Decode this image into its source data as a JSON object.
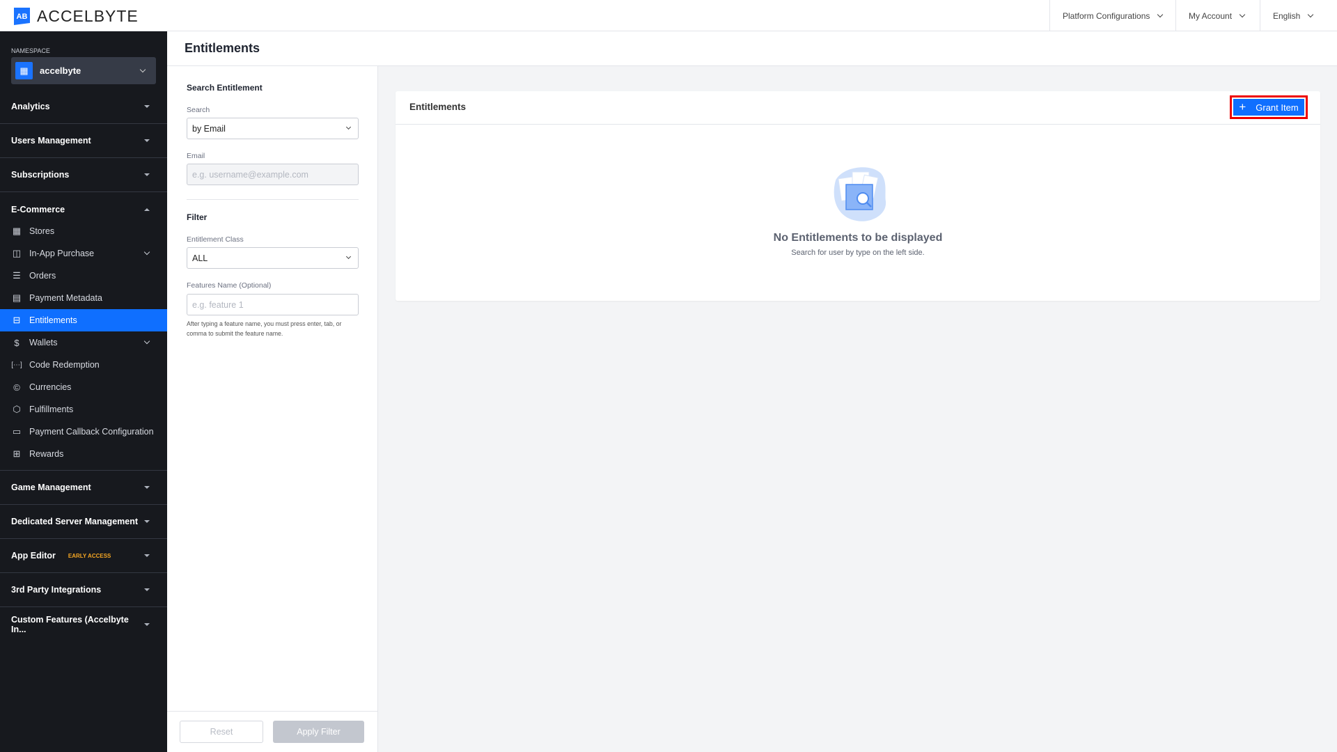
{
  "topbar": {
    "logo_text": "ACCELBYTE",
    "nav": [
      {
        "label": "Platform Configurations"
      },
      {
        "label": "My Account"
      },
      {
        "label": "English"
      }
    ]
  },
  "sidebar": {
    "namespace_label": "NAMESPACE",
    "namespace_value": "accelbyte",
    "sections": [
      {
        "label": "Analytics"
      },
      {
        "label": "Users Management"
      },
      {
        "label": "Subscriptions"
      },
      {
        "label": "E-Commerce"
      },
      {
        "label": "Game Management"
      },
      {
        "label": "Dedicated Server Management"
      },
      {
        "label": "App Editor",
        "badge": "EARLY ACCESS"
      },
      {
        "label": "3rd Party Integrations"
      },
      {
        "label": "Custom Features (Accelbyte In..."
      }
    ],
    "ecommerce_items": [
      {
        "label": "Stores",
        "icon": "store-icon"
      },
      {
        "label": "In-App Purchase",
        "icon": "bag-icon"
      },
      {
        "label": "Orders",
        "icon": "receipt-icon"
      },
      {
        "label": "Payment Metadata",
        "icon": "document-icon"
      },
      {
        "label": "Entitlements",
        "icon": "archive-icon",
        "active": true
      },
      {
        "label": "Wallets",
        "icon": "dollar-icon"
      },
      {
        "label": "Code Redemption",
        "icon": "code-icon"
      },
      {
        "label": "Currencies",
        "icon": "coin-icon"
      },
      {
        "label": "Fulfillments",
        "icon": "box-icon"
      },
      {
        "label": "Payment Callback Configuration",
        "icon": "card-icon"
      },
      {
        "label": "Rewards",
        "icon": "gift-icon"
      }
    ],
    "accent_color": "#0f6fff"
  },
  "page": {
    "title": "Entitlements"
  },
  "filter": {
    "search_title": "Search Entitlement",
    "search_label": "Search",
    "search_value": "by Email",
    "email_label": "Email",
    "email_placeholder": "e.g. username@example.com",
    "filter_title": "Filter",
    "class_label": "Entitlement Class",
    "class_value": "ALL",
    "features_label": "Features Name (Optional)",
    "features_placeholder": "e.g. feature 1",
    "help_text": "After typing a feature name, you must press enter, tab, or comma to submit the feature name.",
    "reset_label": "Reset",
    "apply_label": "Apply Filter"
  },
  "card": {
    "title": "Entitlements",
    "grant_label": "Grant Item",
    "empty_title": "No Entitlements to be displayed",
    "empty_subtitle": "Search for user by type on the left side."
  }
}
